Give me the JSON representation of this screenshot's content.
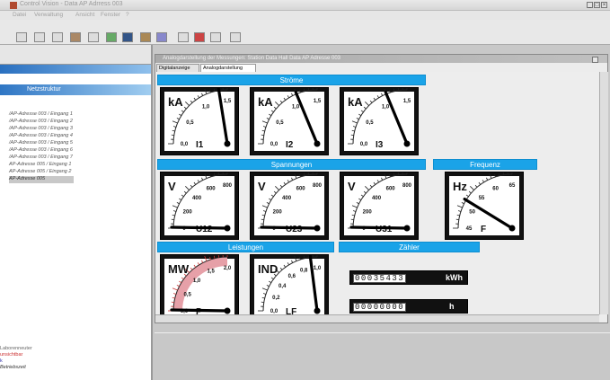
{
  "app": {
    "title": "Control Vision - Data AP Adrress 003",
    "menu": [
      "Datei",
      "Verwaltung",
      "Ansicht",
      "Fenster",
      "?"
    ]
  },
  "sidebar": {
    "header": "Netzstruktur",
    "items": [
      "/AP-Adresse 003 / Eingang 1",
      "/AP-Adresse 003 / Eingang 2",
      "/AP-Adresse 003 / Eingang 3",
      "/AP-Adresse 003 / Eingang 4",
      "/AP-Adresse 003 / Eingang 5",
      "/AP-Adresse 003 / Eingang 6",
      "/AP-Adresse 003 / Eingang 7",
      "AP-Adresse 005 / Eingang 1",
      "AP-Adresse 005 / Eingang 2",
      "AP-Adresse 005"
    ],
    "bottom": [
      "Laborenneuter",
      "unsichtbar",
      "k",
      "Betriebszeit"
    ]
  },
  "child": {
    "title": "Analogdarstellung der Messungen: Station Data Hall Data AP Adresse 003",
    "tabs": [
      "Digitalanzeige",
      "Analogdarstellung"
    ],
    "active_tab": 1
  },
  "sections": {
    "stroeme": "Ströme",
    "spannungen": "Spannungen",
    "frequenz": "Frequenz",
    "leistungen": "Leistungen",
    "zaehler": "Zähler"
  },
  "gauges": {
    "i1": {
      "unit": "kA",
      "ticks": [
        "0,0",
        "0,5",
        "1,0",
        "1,5"
      ],
      "label": "I1",
      "value": 0.9
    },
    "i2": {
      "unit": "kA",
      "ticks": [
        "0,0",
        "0,5",
        "1,0",
        "1,5"
      ],
      "label": "I2",
      "value": 0.75
    },
    "i3": {
      "unit": "kA",
      "ticks": [
        "0,0",
        "0,5",
        "1,0",
        "1,5"
      ],
      "label": "I3",
      "value": 0.75
    },
    "u12": {
      "unit": "V",
      "ticks": [
        "0",
        "200",
        "400",
        "600",
        "800"
      ],
      "label": "U12",
      "value": 0.01
    },
    "u23": {
      "unit": "V",
      "ticks": [
        "0",
        "200",
        "400",
        "600",
        "800"
      ],
      "label": "U23",
      "value": 0.01
    },
    "u31": {
      "unit": "V",
      "ticks": [
        "0",
        "200",
        "400",
        "600",
        "800"
      ],
      "label": "U31",
      "value": 0.01
    },
    "f": {
      "unit": "Hz",
      "ticks": [
        "45",
        "50",
        "55",
        "60",
        "65"
      ],
      "label": "F",
      "value": 0.35
    },
    "p": {
      "unit": "MW",
      "ticks": [
        "0,0",
        "0,5",
        "1,0",
        "1,5",
        "2,0"
      ],
      "label": "P",
      "value": 0.01
    },
    "lf": {
      "unit": "IND",
      "ticks": [
        "0,0",
        "0,2",
        "0,4",
        "0,6",
        "0,8",
        "1,0"
      ],
      "label": "LF",
      "value": 0.92
    }
  },
  "counters": {
    "energy": {
      "value": "00035433",
      "unit": "kWh"
    },
    "hours": {
      "value": "00000000",
      "unit": "h"
    }
  }
}
